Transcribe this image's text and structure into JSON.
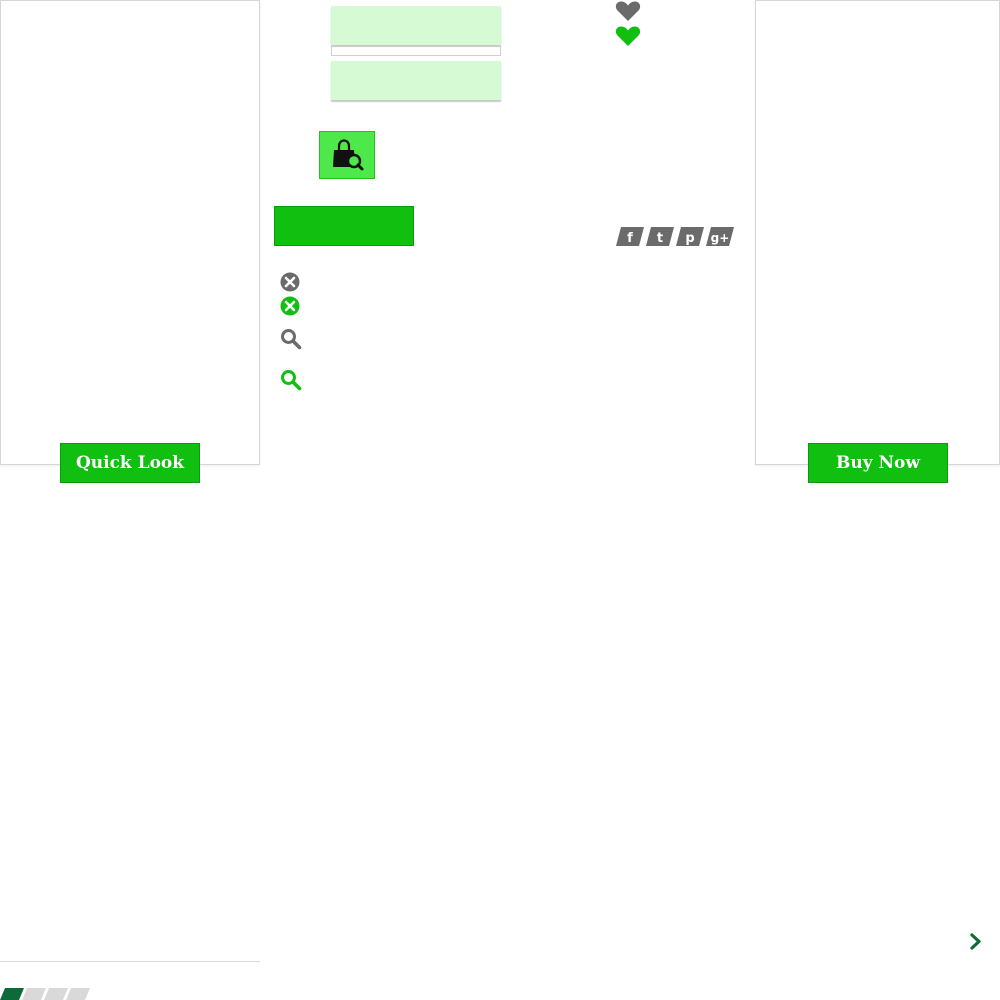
{
  "panels": {
    "left_button_label": "Quick Look",
    "right_button_label": "Buy Now"
  },
  "colors": {
    "brand_green": "#11bf11",
    "light_green": "#d6fbd4",
    "icon_gray": "#6b6b6b",
    "dark_green": "#0f6a3a"
  },
  "icons": {
    "heart_gray": "heart-icon",
    "heart_green": "heart-icon",
    "bag_search": "shopping-bag-search-icon",
    "close_gray": "close-icon",
    "close_green": "close-icon",
    "search_gray": "search-icon",
    "search_green": "search-icon",
    "next": "chevron-right-icon",
    "social": [
      "facebook-icon",
      "twitter-icon",
      "pinterest-icon",
      "google-plus-icon"
    ]
  },
  "pagination": {
    "total": 4,
    "active": 1
  }
}
